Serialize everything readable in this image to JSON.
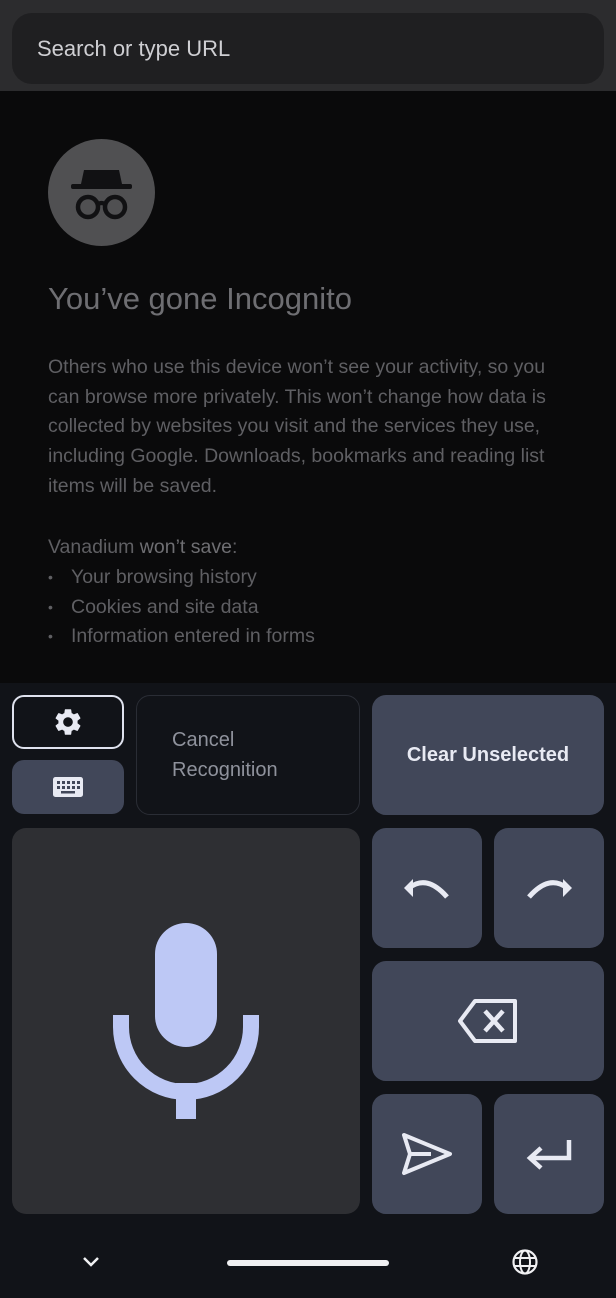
{
  "omnibox": {
    "placeholder": "Search or type URL"
  },
  "incognito_page": {
    "title": "You’ve gone Incognito",
    "description": "Others who use this device won’t see your activity, so you can browse more privately. This won’t change how data is collected by websites you visit and the services they use, including Google. Downloads, bookmarks and reading list items will be saved.",
    "wont_save_prefix": "Vanadium",
    "wont_save_emphasis": "won’t save",
    "wont_save_suffix": ":",
    "wont_save_items": [
      "Your browsing history",
      "Cookies and site data",
      "Information entered in forms"
    ]
  },
  "voice_keyboard": {
    "cancel_label_line1": "Cancel",
    "cancel_label_line2": "Recognition",
    "clear_label": "Clear Unselected",
    "icons": {
      "settings": "gear-icon",
      "keyboard": "keyboard-icon",
      "mic": "microphone-icon",
      "undo": "undo-icon",
      "redo": "redo-icon",
      "backspace": "backspace-icon",
      "send": "send-icon",
      "enter": "enter-icon",
      "collapse": "chevron-down-icon",
      "language": "globe-icon"
    },
    "colors": {
      "accent": "#bdc8f5",
      "button": "#414759",
      "mic_panel": "#2e2f33"
    }
  }
}
